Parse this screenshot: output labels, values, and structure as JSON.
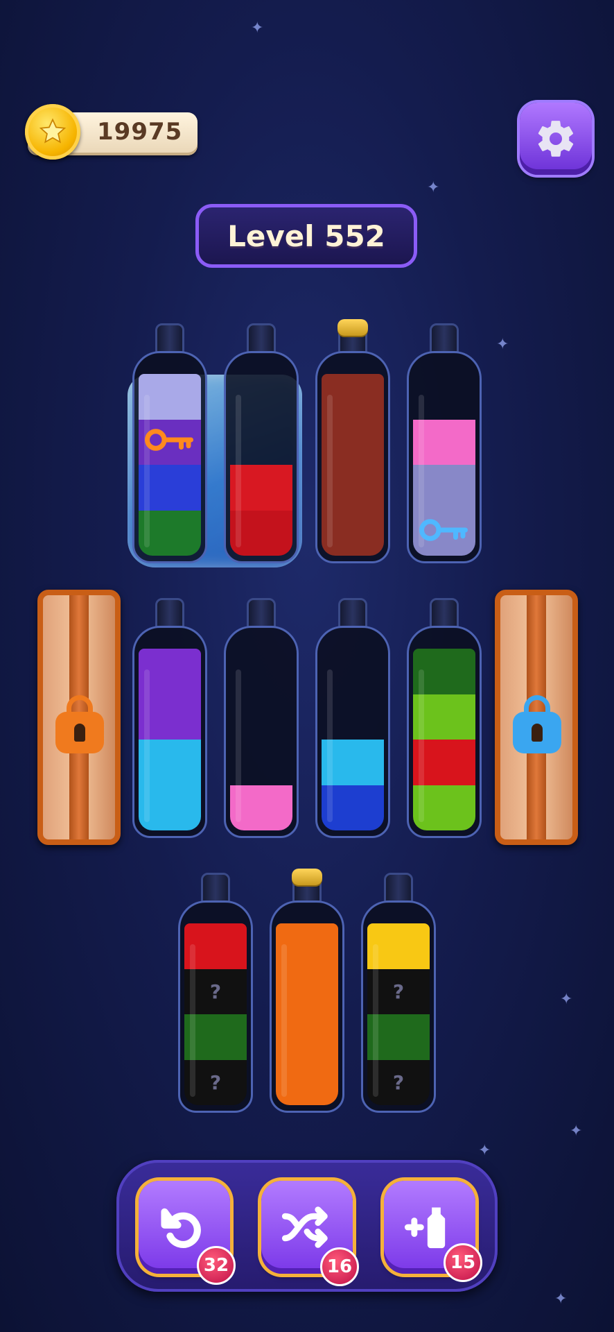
{
  "hud": {
    "coins": "19975",
    "coin_icon": "star-coin-icon",
    "settings_icon": "gear-icon"
  },
  "level": {
    "label": "Level 552"
  },
  "bottles": {
    "row1": [
      {
        "id": "b1",
        "frozen": true,
        "key": "orange",
        "segments": [
          "#1d7a2a",
          "#2a3ed8",
          "#6a2fc0",
          "#a9a9e8"
        ]
      },
      {
        "id": "b2",
        "frozen": true,
        "segments": [
          "#c4121c",
          "#d81822"
        ]
      },
      {
        "id": "b3",
        "cork": true,
        "segments": [
          "#8a2d22",
          "#8a2d22",
          "#8a2d22",
          "#8a2d22"
        ]
      },
      {
        "id": "b4",
        "key": "blue",
        "segments": [
          "#8888c8",
          "#8888c8",
          "#f36ac8"
        ]
      }
    ],
    "row2": [
      {
        "id": "b5",
        "segments": [
          "#29b9ec",
          "#29b9ec",
          "#7b2fcf",
          "#7b2fcf"
        ]
      },
      {
        "id": "b6",
        "segments": [
          "#f36ac8"
        ]
      },
      {
        "id": "b7",
        "segments": [
          "#1d3ed0",
          "#29b9ec"
        ]
      },
      {
        "id": "b8",
        "segments": [
          "#6cc21c",
          "#d8141c",
          "#6cc21c",
          "#1f6a1c"
        ]
      }
    ],
    "row3": [
      {
        "id": "b9",
        "segments": [
          "#111",
          "#1f6a1c",
          "#111",
          "#d8141c"
        ],
        "hidden_mark": "?"
      },
      {
        "id": "b10",
        "cork": true,
        "segments": [
          "#f06a12",
          "#f06a12",
          "#f06a12",
          "#f06a12"
        ]
      },
      {
        "id": "b11",
        "segments": [
          "#111",
          "#1f6a1c",
          "#111",
          "#f8c814"
        ],
        "hidden_mark": "?"
      }
    ]
  },
  "locks": {
    "left": {
      "color": "#f07a1e",
      "icon": "padlock-icon"
    },
    "right": {
      "color": "#3aa6f0",
      "icon": "padlock-icon"
    }
  },
  "toolbar": {
    "undo": {
      "icon": "undo-icon",
      "count": "32"
    },
    "shuffle": {
      "icon": "shuffle-icon",
      "count": "16"
    },
    "add_bottle": {
      "icon": "add-bottle-icon",
      "count": "15"
    }
  }
}
